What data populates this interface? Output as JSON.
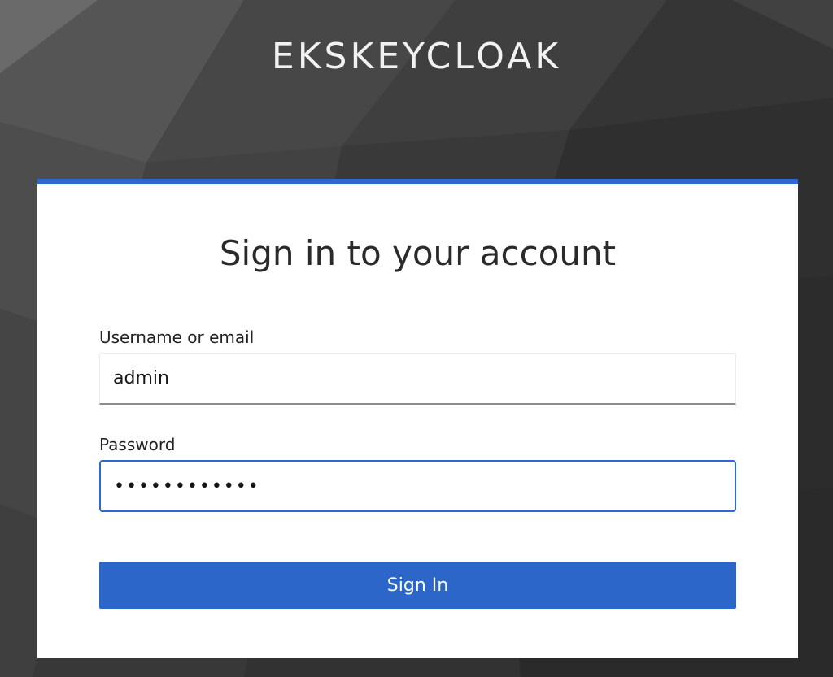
{
  "realm": {
    "title": "EKSKEYCLOAK"
  },
  "login_card": {
    "heading": "Sign in to your account",
    "username": {
      "label": "Username or email",
      "value": "admin"
    },
    "password": {
      "label": "Password",
      "value": "••••••••••••"
    },
    "submit_label": "Sign In"
  },
  "colors": {
    "accent": "#2b6ad0",
    "button": "#2b66c8",
    "background": "#3a3a3a"
  }
}
